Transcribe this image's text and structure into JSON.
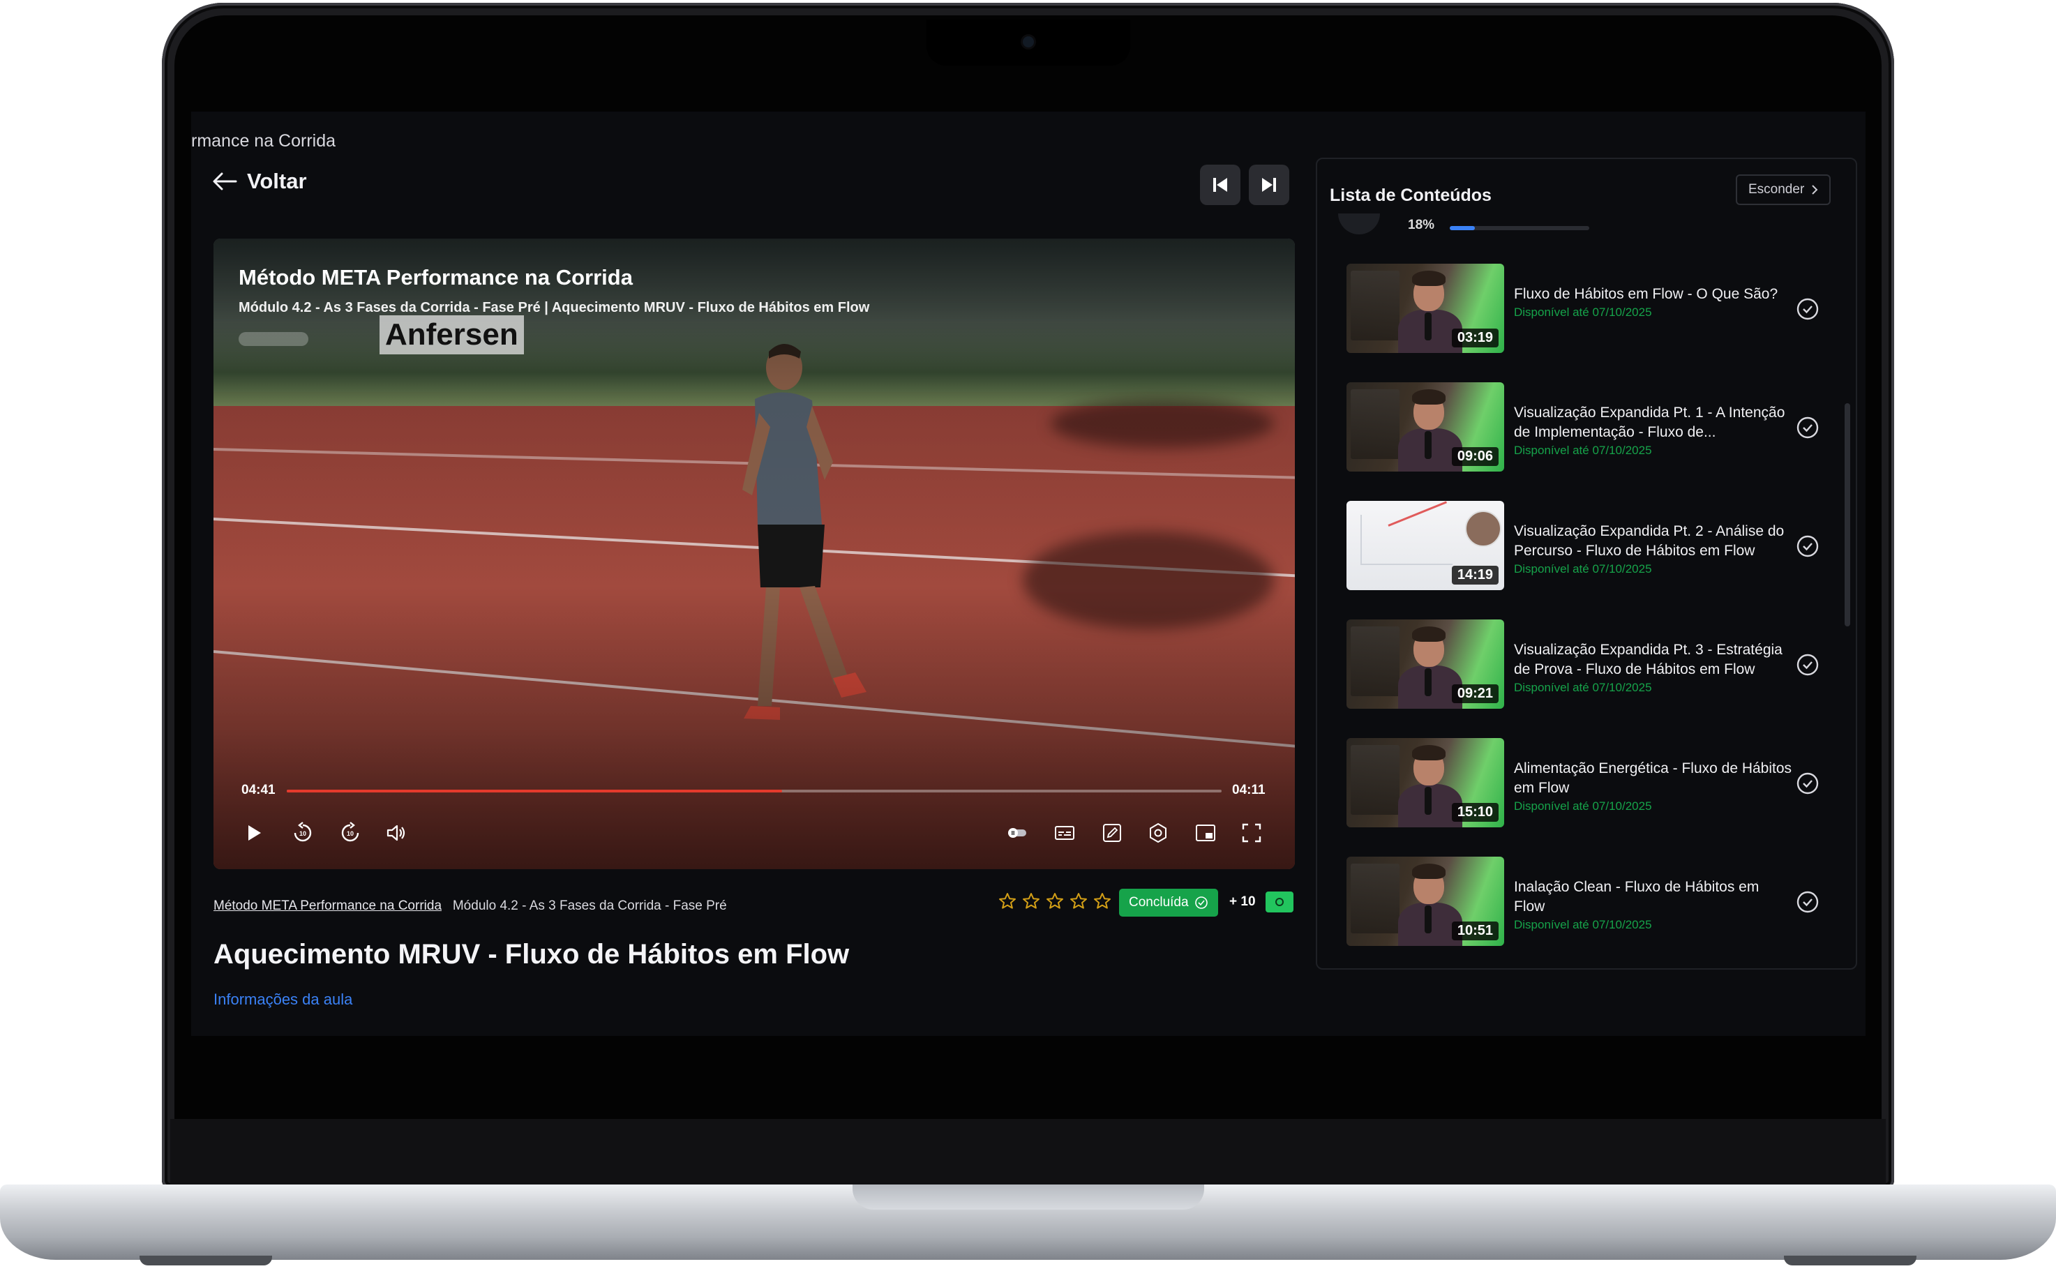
{
  "breadcrumb": "rmance na Corrida",
  "nav": {
    "back_label": "Voltar"
  },
  "player": {
    "course_title": "Método META Performance na Corrida",
    "subtitle": "Módulo 4.2 - As 3 Fases da Corrida - Fase Pré | Aquecimento MRUV - Fluxo de Hábitos em Flow",
    "watermark": "Anfersen",
    "time_current": "04:41",
    "time_duration": "04:11",
    "progress_fraction": 0.53
  },
  "meta": {
    "course_link": "Método META Performance na Corrida",
    "module_text": "Módulo 4.2 - As 3 Fases da Corrida - Fase Pré",
    "rating_stars": 5,
    "done_label": "Concluída",
    "points_label": "+ 10"
  },
  "lesson": {
    "title": "Aquecimento MRUV - Fluxo de Hábitos em Flow",
    "info_link": "Informações da aula"
  },
  "sidebar": {
    "title": "Lista de Conteúdos",
    "hide_label": "Esconder",
    "progress_label": "18%",
    "progress_fraction": 0.18,
    "items": [
      {
        "title": "Fluxo de Hábitos em Flow - O Que São?",
        "duration": "03:19",
        "availability": "Disponível até 07/10/2025"
      },
      {
        "title": "Visualização Expandida Pt. 1 - A Intenção de Implementação - Fluxo de...",
        "duration": "09:06",
        "availability": "Disponível até 07/10/2025"
      },
      {
        "title": "Visualização Expandida Pt. 2 - Análise do Percurso - Fluxo de Hábitos em Flow",
        "duration": "14:19",
        "availability": "Disponível até 07/10/2025"
      },
      {
        "title": "Visualização Expandida Pt. 3 - Estratégia de Prova - Fluxo de Hábitos em Flow",
        "duration": "09:21",
        "availability": "Disponível até 07/10/2025"
      },
      {
        "title": "Alimentação Energética - Fluxo de Hábitos em Flow",
        "duration": "15:10",
        "availability": "Disponível até 07/10/2025"
      },
      {
        "title": "Inalação Clean - Fluxo de Hábitos em Flow",
        "duration": "10:51",
        "availability": "Disponível até 07/10/2025"
      }
    ]
  },
  "colors": {
    "accent_green": "#16a34a",
    "progress_red": "#e53a2c",
    "link_blue": "#3b82f6",
    "star_gold": "#d4a017"
  }
}
